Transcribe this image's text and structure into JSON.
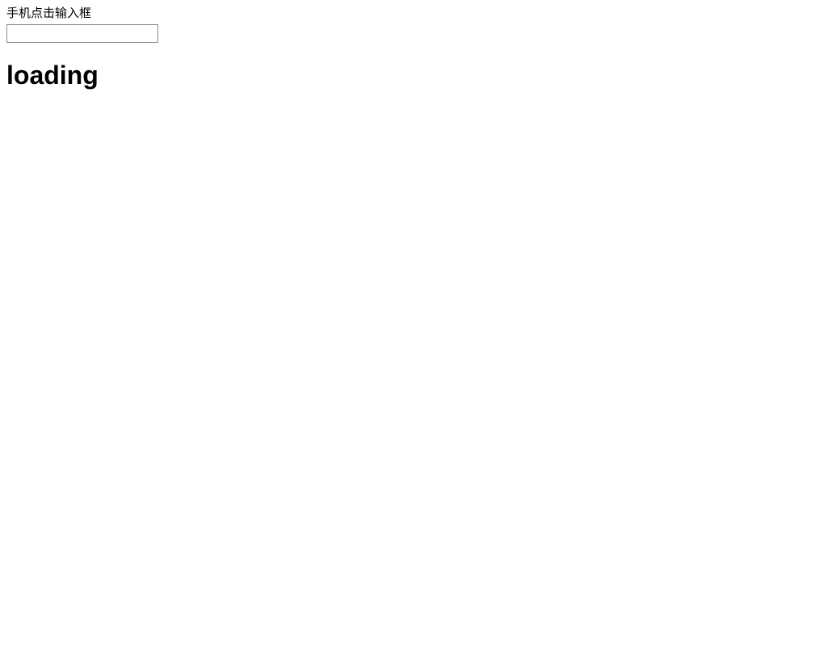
{
  "label_text": "手机点击输入框",
  "input": {
    "value": ""
  },
  "status_heading": "loading"
}
